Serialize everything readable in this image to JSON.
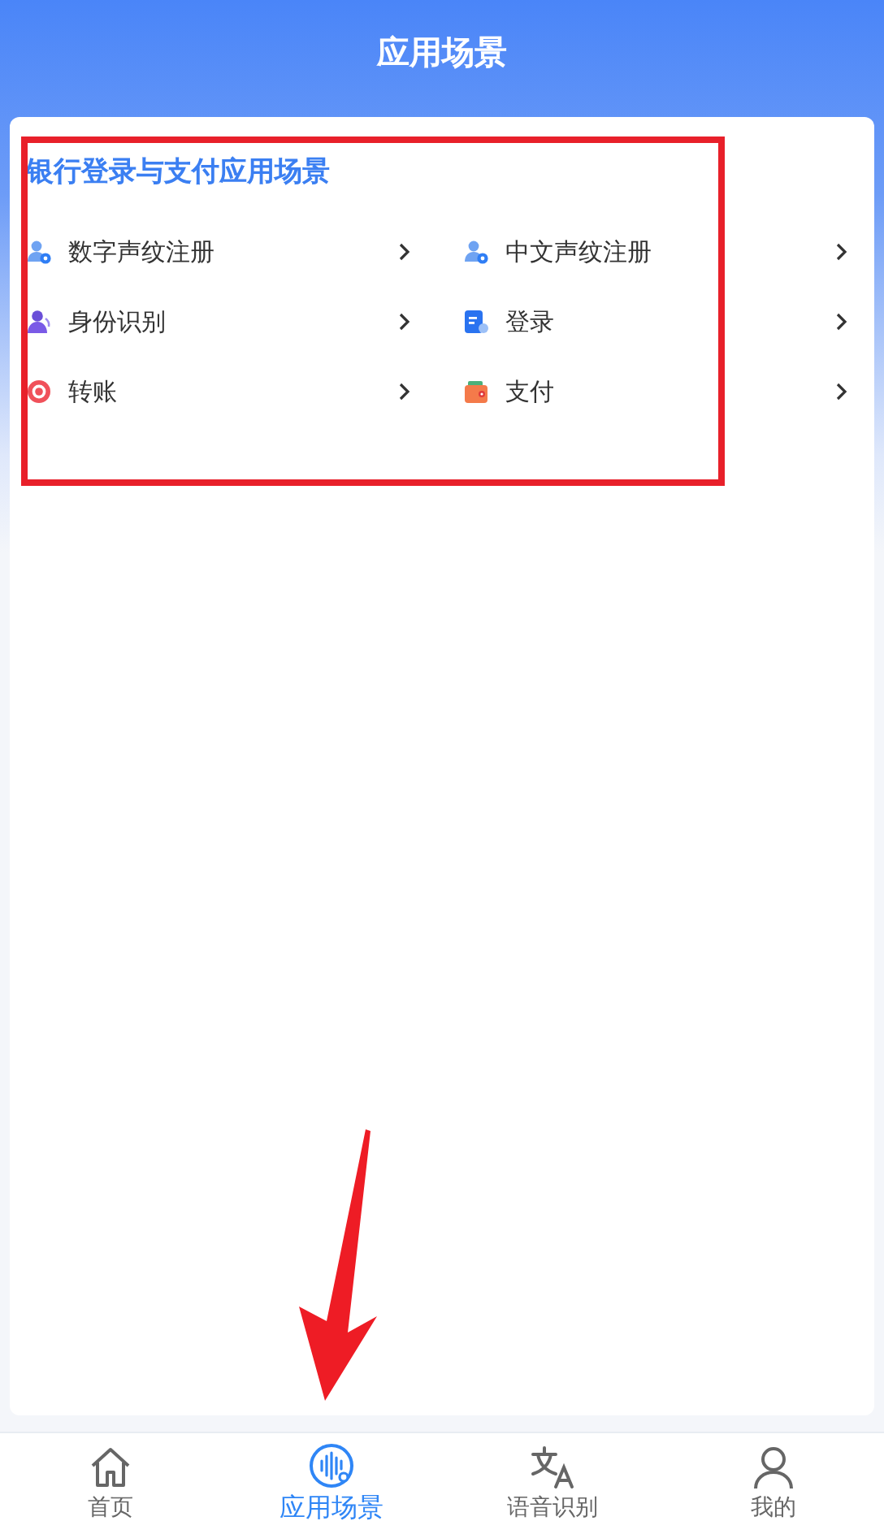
{
  "header": {
    "title": "应用场景"
  },
  "section": {
    "title": "银行登录与支付应用场景",
    "items": [
      {
        "label": "数字声纹注册"
      },
      {
        "label": "中文声纹注册"
      },
      {
        "label": "身份识别"
      },
      {
        "label": "登录"
      },
      {
        "label": "转账"
      },
      {
        "label": "支付"
      }
    ]
  },
  "tab_bar": [
    {
      "label": "首页",
      "selected": false
    },
    {
      "label": "应用场景",
      "selected": true
    },
    {
      "label": "语音识别",
      "selected": false
    },
    {
      "label": "我的",
      "selected": false
    }
  ]
}
